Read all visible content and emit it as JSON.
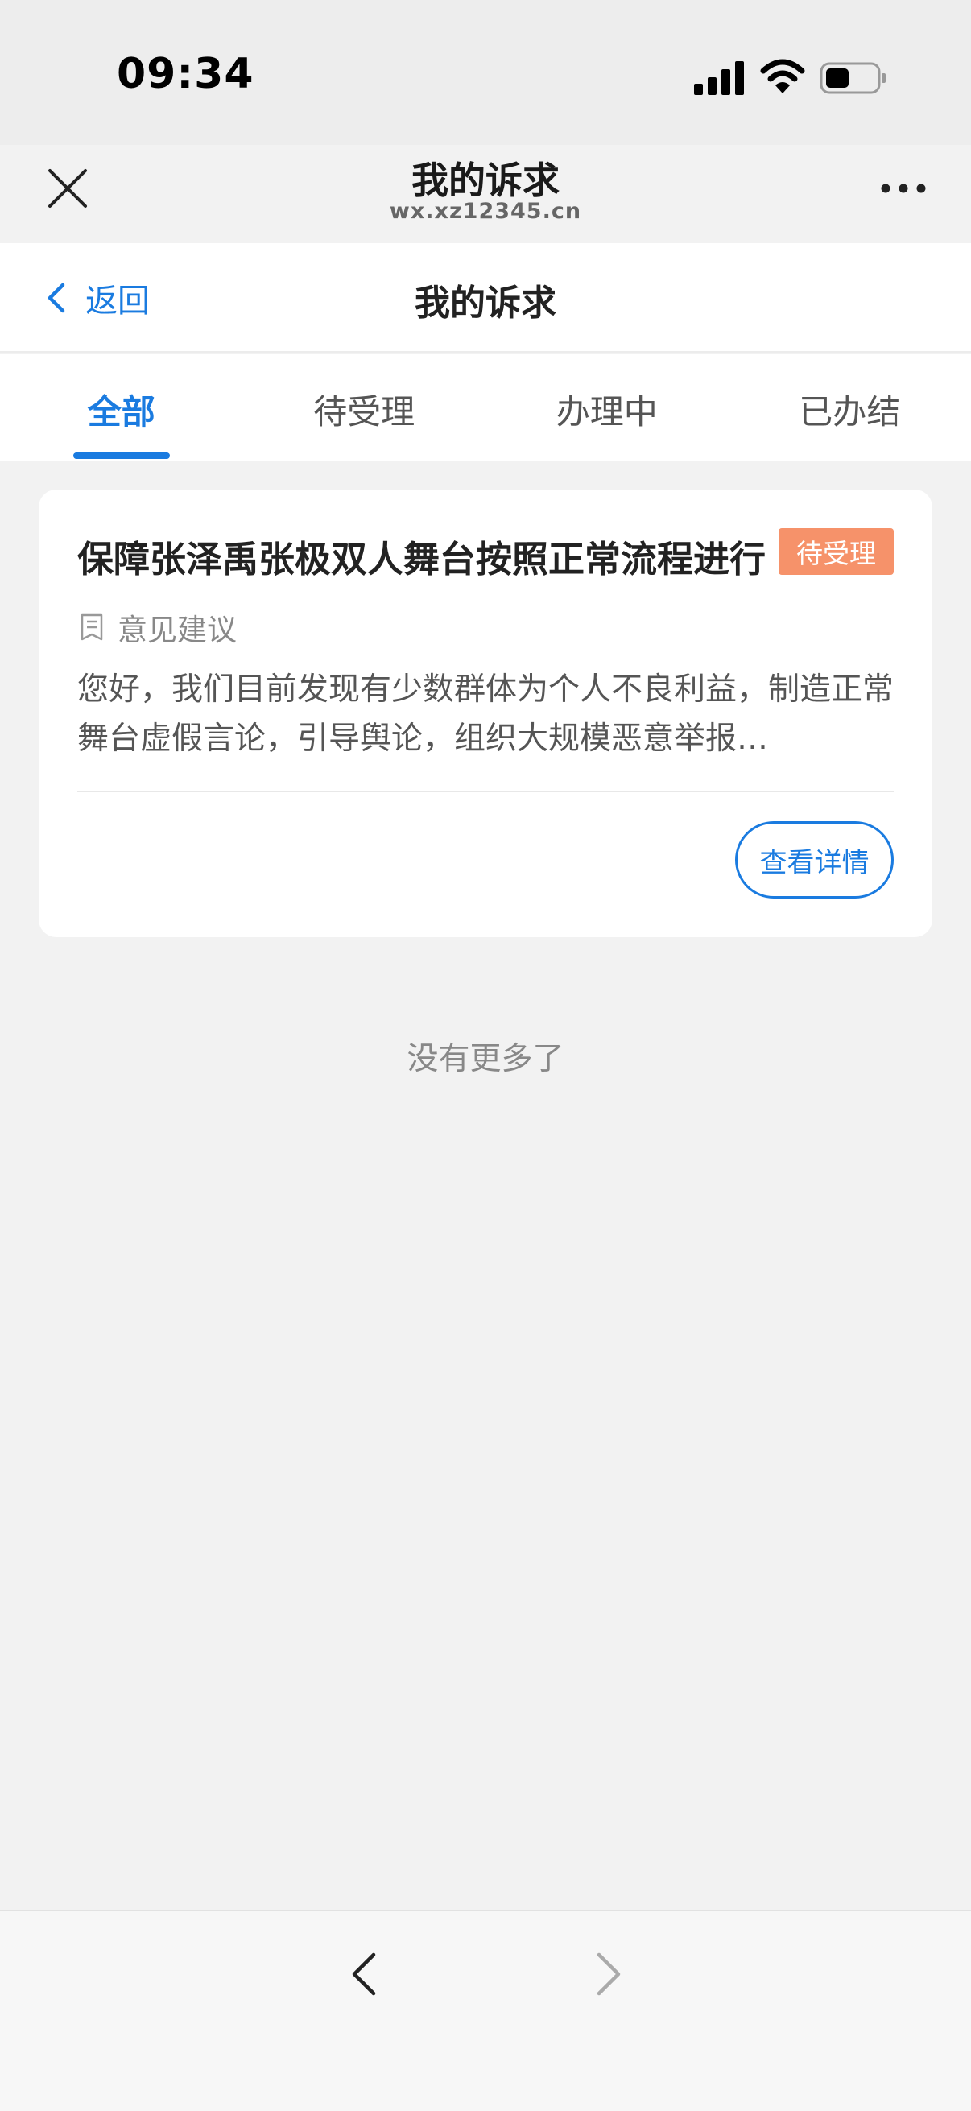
{
  "status_bar": {
    "time": "09:34",
    "signal_icon": "cellular-signal-icon",
    "wifi_icon": "wifi-icon",
    "battery_icon": "battery-icon"
  },
  "browser": {
    "title": "我的诉求",
    "url": "wx.xz12345.cn",
    "close_icon": "close-icon",
    "more_icon": "more-options-icon"
  },
  "header": {
    "back_label": "返回",
    "title": "我的诉求"
  },
  "tabs": [
    {
      "label": "全部",
      "active": true
    },
    {
      "label": "待受理",
      "active": false
    },
    {
      "label": "办理中",
      "active": false
    },
    {
      "label": "已办结",
      "active": false
    }
  ],
  "items": [
    {
      "title": "保障张泽禹张极双人舞台按照正常流程进行",
      "status": "待受理",
      "status_color": "#f6926a",
      "category": "意见建议",
      "description": "您好，我们目前发现有少数群体为个人不良利益，制造正常舞台虚假言论，引导舆论，组织大规模恶意举报…",
      "detail_button": "查看详情"
    }
  ],
  "footer_text": "没有更多了",
  "colors": {
    "accent": "#1a7be0",
    "badge": "#f6926a",
    "background": "#f2f2f2"
  }
}
